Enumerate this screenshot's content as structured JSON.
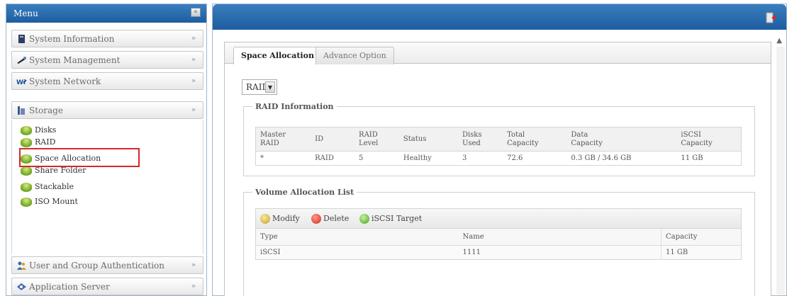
{
  "menu": {
    "title": "Menu",
    "collapse_label": "«",
    "items": [
      {
        "label": "System Information",
        "icon": "system-info-icon"
      },
      {
        "label": "System Management",
        "icon": "system-management-icon"
      },
      {
        "label": "System Network",
        "icon": "network-icon"
      },
      {
        "label": "Storage",
        "icon": "storage-icon"
      },
      {
        "label": "User and Group Authentication",
        "icon": "users-icon"
      },
      {
        "label": "Application Server",
        "icon": "application-server-icon"
      }
    ],
    "chevron": "»",
    "storage_subitems": [
      "Disks",
      "RAID",
      "Space Allocation",
      "Share Folder",
      "Stackable",
      "ISO Mount"
    ],
    "selected_subitem": "Space Allocation"
  },
  "main": {
    "tabs": [
      {
        "label": "Space Allocation",
        "active": true
      },
      {
        "label": "Advance Option",
        "active": false
      }
    ],
    "raid_select": {
      "value": "RAID",
      "arrow": "▼"
    },
    "raid_info": {
      "title": "RAID Information",
      "columns": [
        [
          "Master",
          "RAID"
        ],
        [
          "ID",
          ""
        ],
        [
          "RAID",
          "Level"
        ],
        [
          "Status",
          ""
        ],
        [
          "Disks",
          "Used"
        ],
        [
          "Total",
          "Capacity"
        ],
        [
          "Data",
          "Capacity"
        ],
        [
          "iSCSI",
          "Capacity"
        ]
      ],
      "row": [
        "*",
        "RAID",
        "5",
        "Healthy",
        "3",
        "72.6",
        "0.3 GB / 34.6 GB",
        "11 GB"
      ]
    },
    "volume_list": {
      "title": "Volume Allocation List",
      "toolbar": [
        "Modify",
        "Delete",
        "iSCSI Target"
      ],
      "columns": [
        "Type",
        "Name",
        "Capacity"
      ],
      "row": [
        "iSCSI",
        "1111",
        "11 GB"
      ]
    }
  }
}
